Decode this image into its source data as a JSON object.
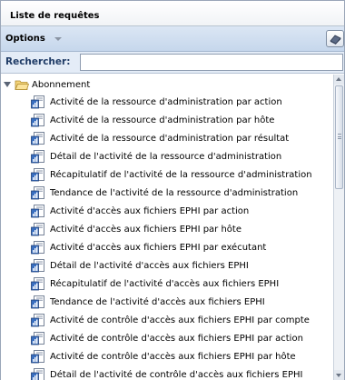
{
  "panel": {
    "title": "Liste de requêtes"
  },
  "toolbar": {
    "options_label": "Options",
    "options_icon": "chevron-down-icon",
    "button_icon": "eraser-icon"
  },
  "search": {
    "label": "Rechercher:",
    "value": "",
    "placeholder": ""
  },
  "tree": {
    "root": {
      "label": "Abonnement",
      "icon": "folder-open-icon",
      "expanded": true
    },
    "items": [
      "Activité de la ressource d'administration par action",
      "Activité de la ressource d'administration par hôte",
      "Activité de la ressource d'administration par résultat",
      "Détail de l'activité de la ressource d'administration",
      "Récapitulatif de l'activité de la ressource d'administration",
      "Tendance de l'activité de la ressource d'administration",
      "Activité d'accès aux fichiers EPHI par action",
      "Activité d'accès aux fichiers EPHI par hôte",
      "Activité d'accès aux fichiers EPHI par exécutant",
      "Détail de l'activité d'accès aux fichiers EPHI",
      "Récapitulatif de l'activité d'accès aux fichiers EPHI",
      "Tendance de l'activité d'accès aux fichiers EPHI",
      "Activité de contrôle d'accès aux fichiers EPHI par compte",
      "Activité de contrôle d'accès aux fichiers EPHI par action",
      "Activité de contrôle d'accès aux fichiers EPHI par hôte",
      "Détail de l'activité de contrôle d'accès aux fichiers EPHI"
    ],
    "item_icon": "report-icon"
  },
  "colors": {
    "toolbar_bg": "#c6d7ec",
    "search_label": "#1f3b66",
    "folder": "#e8c35a",
    "report_icon": "#2d5fa8"
  }
}
